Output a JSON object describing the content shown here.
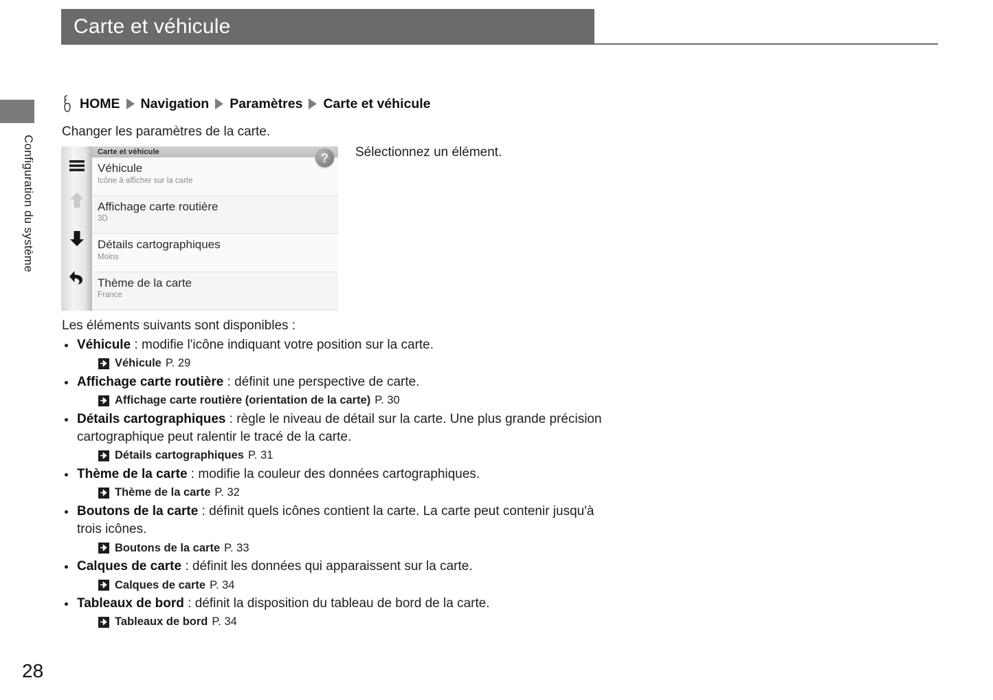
{
  "header": {
    "title": "Carte et véhicule"
  },
  "side_tab": {
    "label": "Configuration du système"
  },
  "breadcrumb": {
    "icon": "press-finger-icon",
    "separator_icon": "triangle-right-icon",
    "items": [
      "HOME",
      "Navigation",
      "Paramètres",
      "Carte et véhicule"
    ]
  },
  "intro_text": "Changer les paramètres de la carte.",
  "side_note": "Sélectionnez un élément.",
  "device_screenshot": {
    "title": "Carte et véhicule",
    "help_icon_label": "?",
    "sidebar_icons": [
      {
        "name": "menu-hamburger-icon",
        "state": "enabled"
      },
      {
        "name": "scroll-up-arrow-icon",
        "state": "disabled"
      },
      {
        "name": "scroll-down-arrow-icon",
        "state": "enabled"
      },
      {
        "name": "back-arrow-icon",
        "state": "enabled"
      }
    ],
    "rows": [
      {
        "title": "Véhicule",
        "subtitle": "Icône à afficher sur la carte"
      },
      {
        "title": "Affichage carte routière",
        "subtitle": "3D"
      },
      {
        "title": "Détails cartographiques",
        "subtitle": "Moins"
      },
      {
        "title": "Thème de la carte",
        "subtitle": "France"
      }
    ]
  },
  "body": {
    "lead": "Les éléments suivants sont disponibles :",
    "bullets": [
      {
        "term": "Véhicule",
        "description": " : modifie l'icône indiquant votre position sur la carte.",
        "xref_label": "Véhicule",
        "xref_page": "P. 29"
      },
      {
        "term": "Affichage carte routière",
        "description": " : définit une perspective de carte.",
        "xref_label": "Affichage carte routière (orientation de la carte)",
        "xref_page": "P. 30"
      },
      {
        "term": "Détails cartographiques",
        "description": " : règle le niveau de détail sur la carte. Une plus grande précision cartographique peut ralentir le tracé de la carte.",
        "xref_label": "Détails cartographiques",
        "xref_page": "P. 31"
      },
      {
        "term": "Thème de la carte",
        "description": " : modifie la couleur des données cartographiques.",
        "xref_label": "Thème de la carte",
        "xref_page": "P. 32"
      },
      {
        "term": "Boutons de la carte",
        "description": " : définit quels icônes contient la carte. La carte peut contenir jusqu'à trois icônes.",
        "xref_label": "Boutons de la carte",
        "xref_page": "P. 33"
      },
      {
        "term": "Calques de carte",
        "description": " : définit les données qui apparaissent sur la carte.",
        "xref_label": "Calques de carte",
        "xref_page": "P. 34"
      },
      {
        "term": "Tableaux de bord",
        "description": " : définit la disposition du tableau de bord de la carte.",
        "xref_label": "Tableaux de bord",
        "xref_page": "P. 34"
      }
    ]
  },
  "page_number": "28",
  "colors": {
    "header_bar": "#6b6b6b",
    "side_tab": "#7a7a7a",
    "text": "#1f1f1f"
  }
}
